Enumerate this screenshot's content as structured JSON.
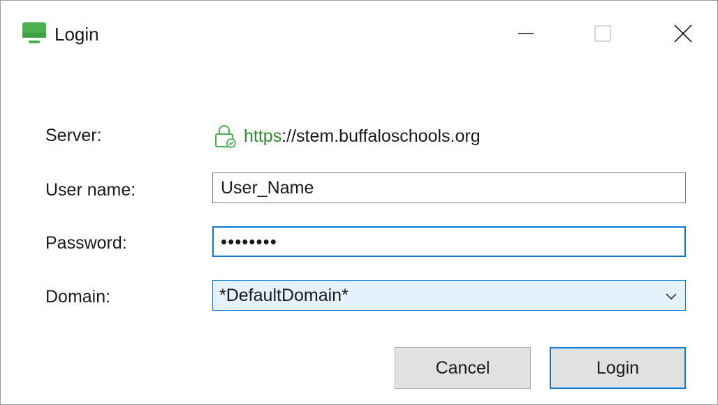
{
  "window": {
    "title": "Login",
    "icon": "monitor-icon",
    "controls": [
      "minimize-icon",
      "maximize-icon",
      "close-icon"
    ]
  },
  "form": {
    "server_label": "Server:",
    "server_scheme": "https",
    "server_rest": "://stem.buffaloschools.org",
    "server_icon": "secure-lock-icon",
    "username_label": "User name:",
    "username_value": "User_Name",
    "password_label": "Password:",
    "password_value": "••••••••",
    "domain_label": "Domain:",
    "domain_value": "*DefaultDomain*"
  },
  "buttons": {
    "cancel": "Cancel",
    "login": "Login"
  },
  "colors": {
    "accent": "#0a78d4",
    "secure_green": "#2e8b2e",
    "icon_green": "#4caf50",
    "dropdown_bg": "#e5f1fb",
    "button_bg": "#e1e1e1"
  }
}
